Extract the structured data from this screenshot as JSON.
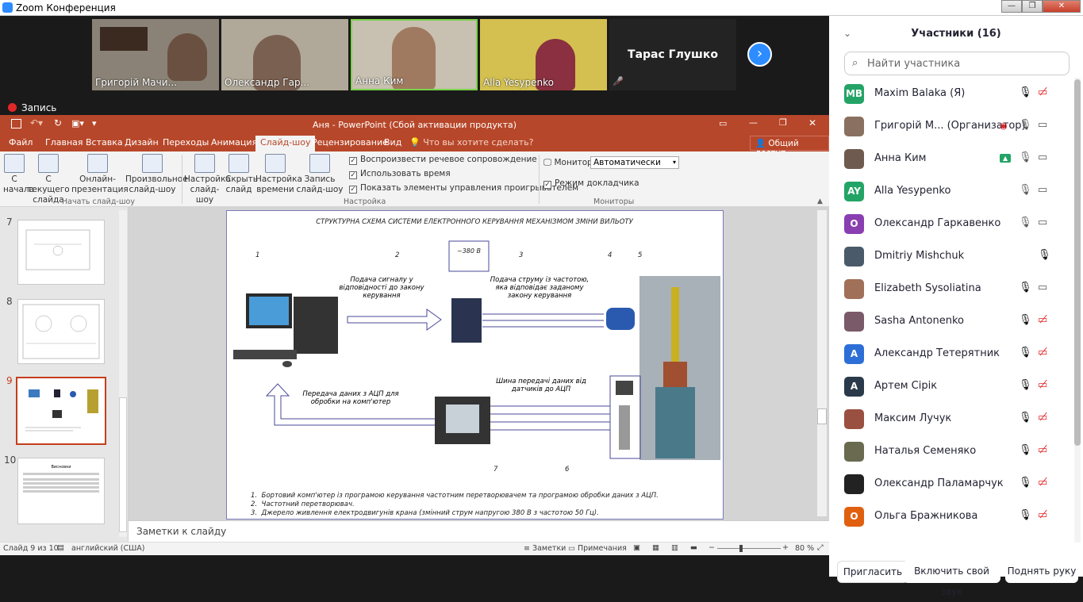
{
  "window": {
    "title": "Zoom Конференция"
  },
  "videos": [
    {
      "name": "Григорій Мачи..."
    },
    {
      "name": "Олександр Гар..."
    },
    {
      "name": "Анна Ким"
    },
    {
      "name": "Alla Yesypenko"
    },
    {
      "name": "Тарас Глушко"
    }
  ],
  "recording": {
    "label": "Запись"
  },
  "ppt": {
    "title": "Аня - PowerPoint (Сбой активации продукта)",
    "tabs": [
      "Файл",
      "Главная",
      "Вставка",
      "Дизайн",
      "Переходы",
      "Анимация",
      "Слайд-шоу",
      "Рецензирование",
      "Вид"
    ],
    "active_tab": "Слайд-шоу",
    "tell_me": "Что вы хотите сделать?",
    "share": "Общий доступ",
    "ribbon": {
      "from_start": "С начала",
      "from_current": "С текущего слайда",
      "online": "Онлайн-презентация",
      "custom": "Произвольное слайд-шоу",
      "group_start": "Начать слайд-шоу",
      "setup": "Настройка слайд-шоу",
      "hide": "Скрыть слайд",
      "timing": "Настройка времени",
      "record": "Запись слайд-шоу",
      "chk_narration": "Воспроизвести речевое сопровождение",
      "chk_timings": "Использовать время",
      "chk_controls": "Показать элементы управления проигрывателем",
      "group_setup": "Настройка",
      "monitor_label": "Монитор:",
      "monitor_value": "Автоматически",
      "presenter_view": "Режим докладчика",
      "group_monitors": "Мониторы"
    },
    "thumbs": [
      "7",
      "8",
      "9",
      "10"
    ],
    "thumb10_title": "Висновки",
    "slide": {
      "title": "СТРУКТУРНА СХЕМА СИСТЕМИ ЕЛЕКТРОННОГО КЕРУВАННЯ МЕХАНІЗМОМ ЗМІНИ ВИЛЬОТУ",
      "n1": "1",
      "n2": "2",
      "n3": "3",
      "n4": "4",
      "n5": "5",
      "n6": "6",
      "n7": "7",
      "voltage": "~380 В",
      "signal": "Подача сигналу у відповідності до закону керування",
      "current": "Подача струму із частотою, яка відповідає заданому закону керування",
      "transfer": "Передача даних з АЦП для обробки на комп'ютер",
      "bus": "Шина передачі даних від датчиків до АЦП",
      "list": [
        "Бортовий комп'ютер із програмою керування частотним перетворювачем та програмою обробки даних з АЦП.",
        "Частотний перетворювач.",
        "Джерело живлення електродвигунів крана (змінний струм напругою 380 В з частотою 50 Гц)."
      ]
    },
    "notes": "Заметки к слайду",
    "status": {
      "slide": "Слайд 9 из 10",
      "lang": "английский (США)",
      "notes": "Заметки",
      "comments": "Примечания",
      "zoom": "80 %"
    }
  },
  "panel": {
    "title": "Участники (16)",
    "search_placeholder": "Найти участника",
    "participants": [
      {
        "initials": "MB",
        "name": "Maxim Balaka (Я)",
        "color": "#23a466"
      },
      {
        "initials": "",
        "name": "Григорій М...  (Организатор)",
        "color": "#8a7060"
      },
      {
        "initials": "",
        "name": "Анна Ким",
        "color": "#6f5a50"
      },
      {
        "initials": "AY",
        "name": "Alla Yesypenko",
        "color": "#23a466"
      },
      {
        "initials": "О",
        "name": "Олександр Гаркавенко",
        "color": "#8a3fb0"
      },
      {
        "initials": "",
        "name": "Dmitriy Mishchuk",
        "color": "#4a5a6a"
      },
      {
        "initials": "",
        "name": "Elizabeth Sysoliatina",
        "color": "#a07058"
      },
      {
        "initials": "",
        "name": "Sasha Antonenko",
        "color": "#7a5a68"
      },
      {
        "initials": "А",
        "name": "Александр Тетерятник",
        "color": "#2d6fd6"
      },
      {
        "initials": "А",
        "name": "Артем Сірік",
        "color": "#2a3a4a"
      },
      {
        "initials": "",
        "name": "Максим Лучук",
        "color": "#9a5040"
      },
      {
        "initials": "",
        "name": "Наталья Семеняко",
        "color": "#6a6a50"
      },
      {
        "initials": "",
        "name": "Олександр Паламарчук",
        "color": "#222222"
      },
      {
        "initials": "О",
        "name": "Ольга Бражникова",
        "color": "#e06010"
      }
    ],
    "invite": "Пригласить",
    "unmute": "Включить свой звук",
    "raise": "Поднять руку"
  },
  "colors": {
    "ppt_accent": "#b7472a",
    "zoom_blue": "#2d8cff",
    "mute_red": "#e02828"
  }
}
